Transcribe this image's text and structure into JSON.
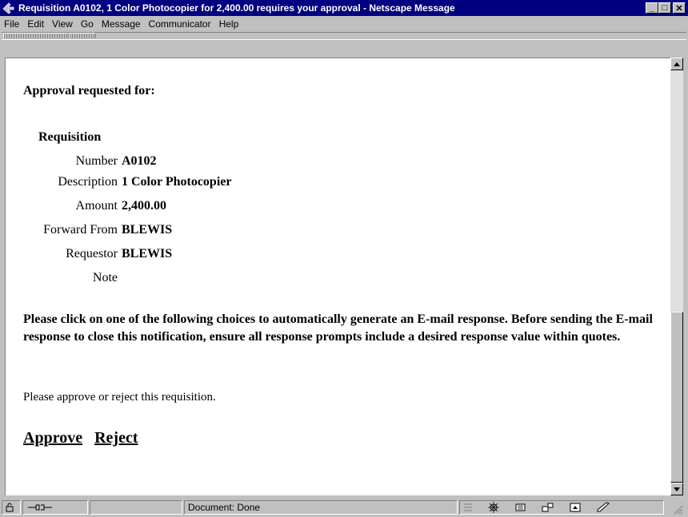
{
  "window": {
    "title": "Requisition A0102, 1 Color Photocopier for 2,400.00 requires your approval - Netscape Message",
    "minimize": "_",
    "maximize": "□",
    "close": "✕"
  },
  "menu": {
    "file": "File",
    "edit": "Edit",
    "view": "View",
    "go": "Go",
    "message": "Message",
    "communicator": "Communicator",
    "help": "Help"
  },
  "content": {
    "heading": "Approval requested for:",
    "section_title": "Requisition",
    "fields": [
      {
        "label": "Number",
        "value": "A0102"
      },
      {
        "label": "Description",
        "value": "1 Color Photocopier"
      },
      {
        "label": "Amount",
        "value": "2,400.00"
      },
      {
        "label": "Forward From",
        "value": "BLEWIS"
      },
      {
        "label": "Requestor",
        "value": "BLEWIS"
      },
      {
        "label": "Note",
        "value": ""
      }
    ],
    "instructions": "Please click on one of the following choices to automatically generate an E-mail response. Before sending the E-mail response to close this notification, ensure all response prompts include a desired response value within quotes.",
    "prompt": "Please approve or reject this requisition.",
    "approve_label": "Approve",
    "reject_label": "Reject"
  },
  "status": {
    "text": "Document: Done"
  },
  "colors": {
    "titlebar": "#000080",
    "chrome": "#c0c0c0",
    "content_bg": "#ffffff"
  }
}
